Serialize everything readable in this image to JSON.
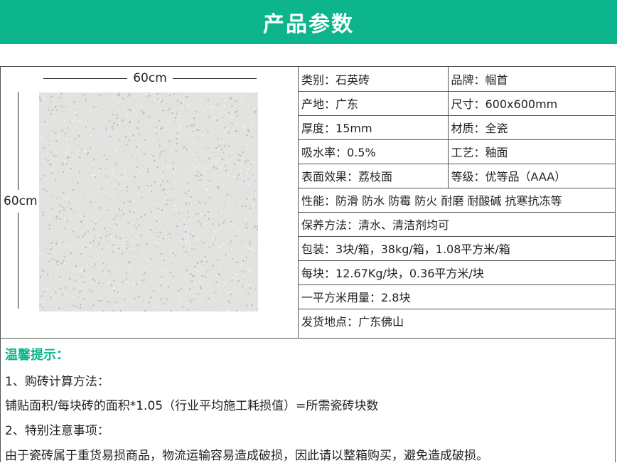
{
  "header": {
    "title": "产品参数"
  },
  "dimensions": {
    "width_label": "60cm",
    "height_label": "60cm"
  },
  "tile": {
    "base_color": "#e2e3e1",
    "speckle_color": "#b8b9b6",
    "light_color": "#f2f2f0"
  },
  "specs": {
    "rows": [
      {
        "cells": [
          {
            "label": "类别：",
            "value": "石英砖"
          },
          {
            "label": "品牌：",
            "value": "帼首"
          }
        ]
      },
      {
        "cells": [
          {
            "label": "产地：",
            "value": "广东"
          },
          {
            "label": "尺寸：",
            "value": "600x600mm"
          }
        ]
      },
      {
        "cells": [
          {
            "label": "厚度：",
            "value": "15mm"
          },
          {
            "label": "材质：",
            "value": "全瓷"
          }
        ]
      },
      {
        "cells": [
          {
            "label": "吸水率：",
            "value": "0.5%"
          },
          {
            "label": "工艺：",
            "value": "釉面"
          }
        ]
      },
      {
        "cells": [
          {
            "label": "表面效果：",
            "value": "荔枝面"
          },
          {
            "label": "等级：",
            "value": "优等品（AAA）"
          }
        ]
      },
      {
        "cells": [
          {
            "label": "性能：",
            "value": "防滑 防水 防霉 防火 耐磨 耐酸碱 抗寒抗冻等"
          }
        ]
      },
      {
        "cells": [
          {
            "label": "保养方法：",
            "value": "清水、清洁剂均可"
          }
        ]
      },
      {
        "cells": [
          {
            "label": "包装：",
            "value": "3块/箱，38kg/箱，1.08平方米/箱"
          }
        ]
      },
      {
        "cells": [
          {
            "label": "每块：",
            "value": "12.67Kg/块，0.36平方米/块"
          }
        ]
      },
      {
        "cells": [
          {
            "label": "一平方米用量：",
            "value": "2.8块"
          }
        ]
      },
      {
        "cells": [
          {
            "label": "发货地点：",
            "value": "广东佛山"
          }
        ]
      }
    ]
  },
  "tips": {
    "title": "温馨提示：",
    "lines": [
      "1、购砖计算方法：",
      "铺贴面积/每块砖的面积*1.05（行业平均施工耗损值）=所需瓷砖块数",
      "2、特别注意事项：",
      "由于瓷砖属于重货易损商品，物流运输容易造成破损，因此请以整箱购买，避免造成破损。"
    ]
  },
  "colors": {
    "accent": "#0cb58c",
    "border": "#555555",
    "text": "#222222"
  }
}
